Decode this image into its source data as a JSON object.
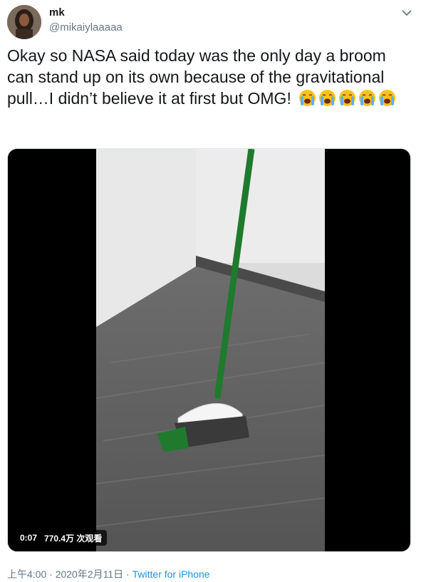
{
  "author": {
    "name": "mk",
    "handle": "@mikaiylaaaaa"
  },
  "tweet": {
    "text": "Okay so NASA said today was the only day a broom can stand up on its own because of the gravitational pull…I didn’t believe it at first but OMG!",
    "emoji_icon": "loudly-crying-face-icon",
    "emoji_count": 5
  },
  "video": {
    "duration": "0:07",
    "views": "770.4万 次观看"
  },
  "footer": {
    "time": "上午4:00",
    "separator1": " · ",
    "date": "2020年2月11日",
    "separator2": " · ",
    "source": "Twitter for iPhone"
  },
  "colors": {
    "link": "#1b95e0",
    "secondary": "#657786",
    "broom_green": "#1f7a2e"
  }
}
